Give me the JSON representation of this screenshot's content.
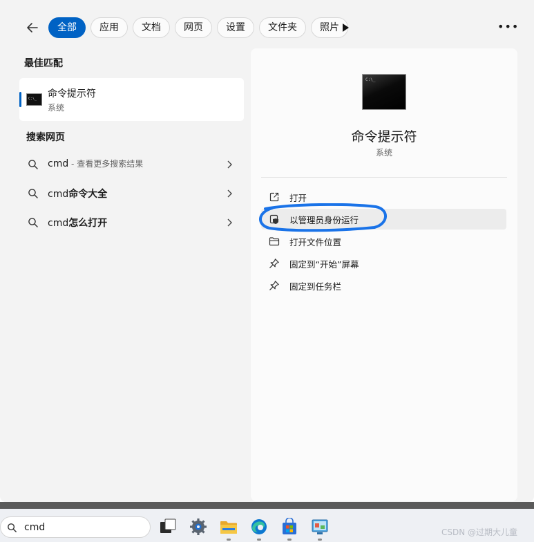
{
  "filters": {
    "items": [
      {
        "label": "全部",
        "active": true
      },
      {
        "label": "应用",
        "active": false
      },
      {
        "label": "文档",
        "active": false
      },
      {
        "label": "网页",
        "active": false
      },
      {
        "label": "设置",
        "active": false
      },
      {
        "label": "文件夹",
        "active": false
      },
      {
        "label": "照片",
        "active": false
      }
    ]
  },
  "best_match": {
    "section_title": "最佳匹配",
    "title": "命令提示符",
    "subtitle": "系统",
    "icon": "cmd-terminal-icon"
  },
  "web_search": {
    "section_title": "搜索网页",
    "items": [
      {
        "query": "cmd",
        "hint": " - 查看更多搜索结果"
      },
      {
        "query": "cmd",
        "bold_suffix": "命令大全"
      },
      {
        "query": "cmd",
        "bold_suffix": "怎么打开"
      }
    ]
  },
  "detail": {
    "title": "命令提示符",
    "subtitle": "系统",
    "actions": [
      {
        "label": "打开",
        "icon": "open-external-icon",
        "highlighted": false
      },
      {
        "label": "以管理员身份运行",
        "icon": "shield-admin-icon",
        "highlighted": true
      },
      {
        "label": "打开文件位置",
        "icon": "folder-icon",
        "highlighted": false
      },
      {
        "label": "固定到“开始”屏幕",
        "icon": "pin-icon",
        "highlighted": false
      },
      {
        "label": "固定到任务栏",
        "icon": "pin-icon",
        "highlighted": false
      }
    ],
    "annotation_color": "#1a73e8"
  },
  "taskbar": {
    "search_value": "cmd",
    "apps": [
      "task-view-icon",
      "settings-gear-icon",
      "file-explorer-icon",
      "edge-browser-icon",
      "microsoft-store-icon",
      "control-panel-icon"
    ],
    "watermark": "CSDN @过期大儿童"
  },
  "colors": {
    "accent": "#0062c4",
    "panel": "#f3f3f3",
    "detail": "#fbfbfb"
  }
}
